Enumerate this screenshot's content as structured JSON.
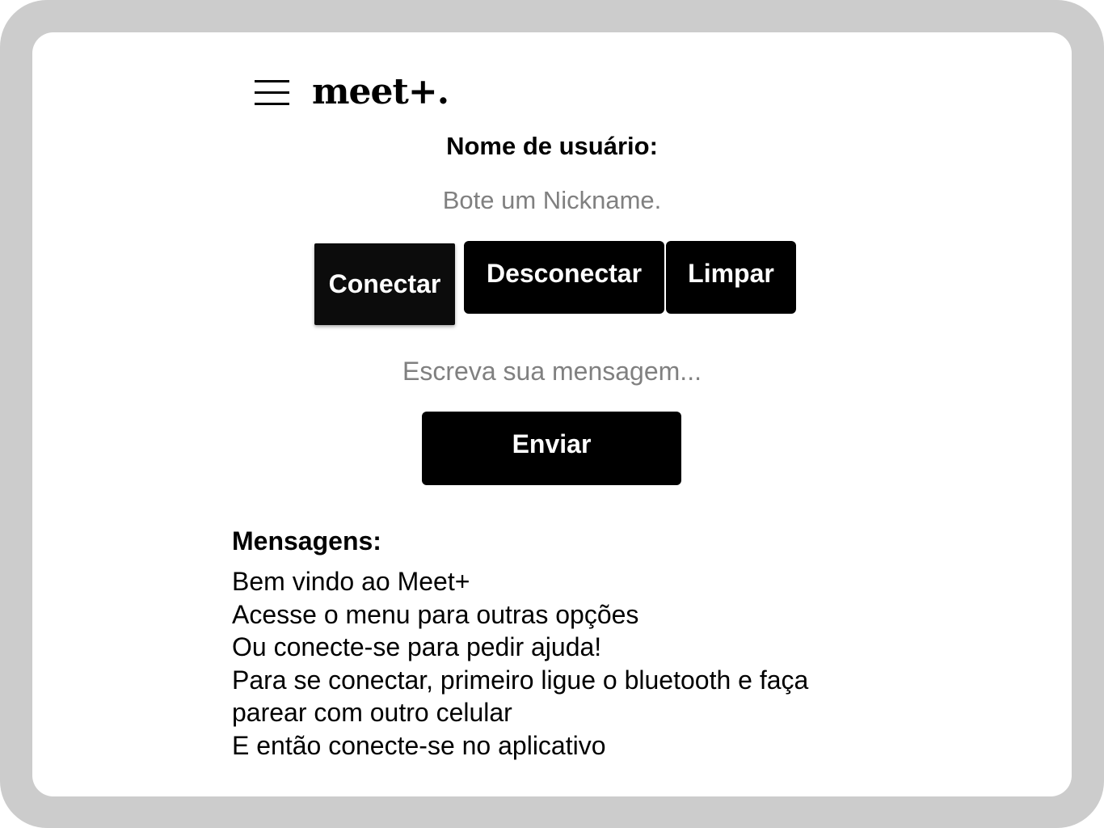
{
  "header": {
    "menu_icon": "hamburger-menu-icon",
    "logo": "meet+."
  },
  "form": {
    "username_label": "Nome de usuário:",
    "username_value": "",
    "username_placeholder": "Bote um Nickname.",
    "buttons": {
      "connect": "Conectar",
      "disconnect": "Desconectar",
      "clear": "Limpar"
    },
    "message_value": "",
    "message_placeholder": "Escreva sua mensagem...",
    "send": "Enviar"
  },
  "messages": {
    "title": "Mensagens:",
    "lines": [
      "Bem vindo ao Meet+",
      "Acesse o menu para outras opções",
      "Ou conecte-se para pedir ajuda!",
      "Para se conectar, primeiro ligue o bluetooth e faça parear com outro celular",
      "E então conecte-se no aplicativo"
    ]
  },
  "colors": {
    "frame": "#cccccc",
    "background": "#ffffff",
    "button": "#000000",
    "placeholder": "#808080"
  }
}
